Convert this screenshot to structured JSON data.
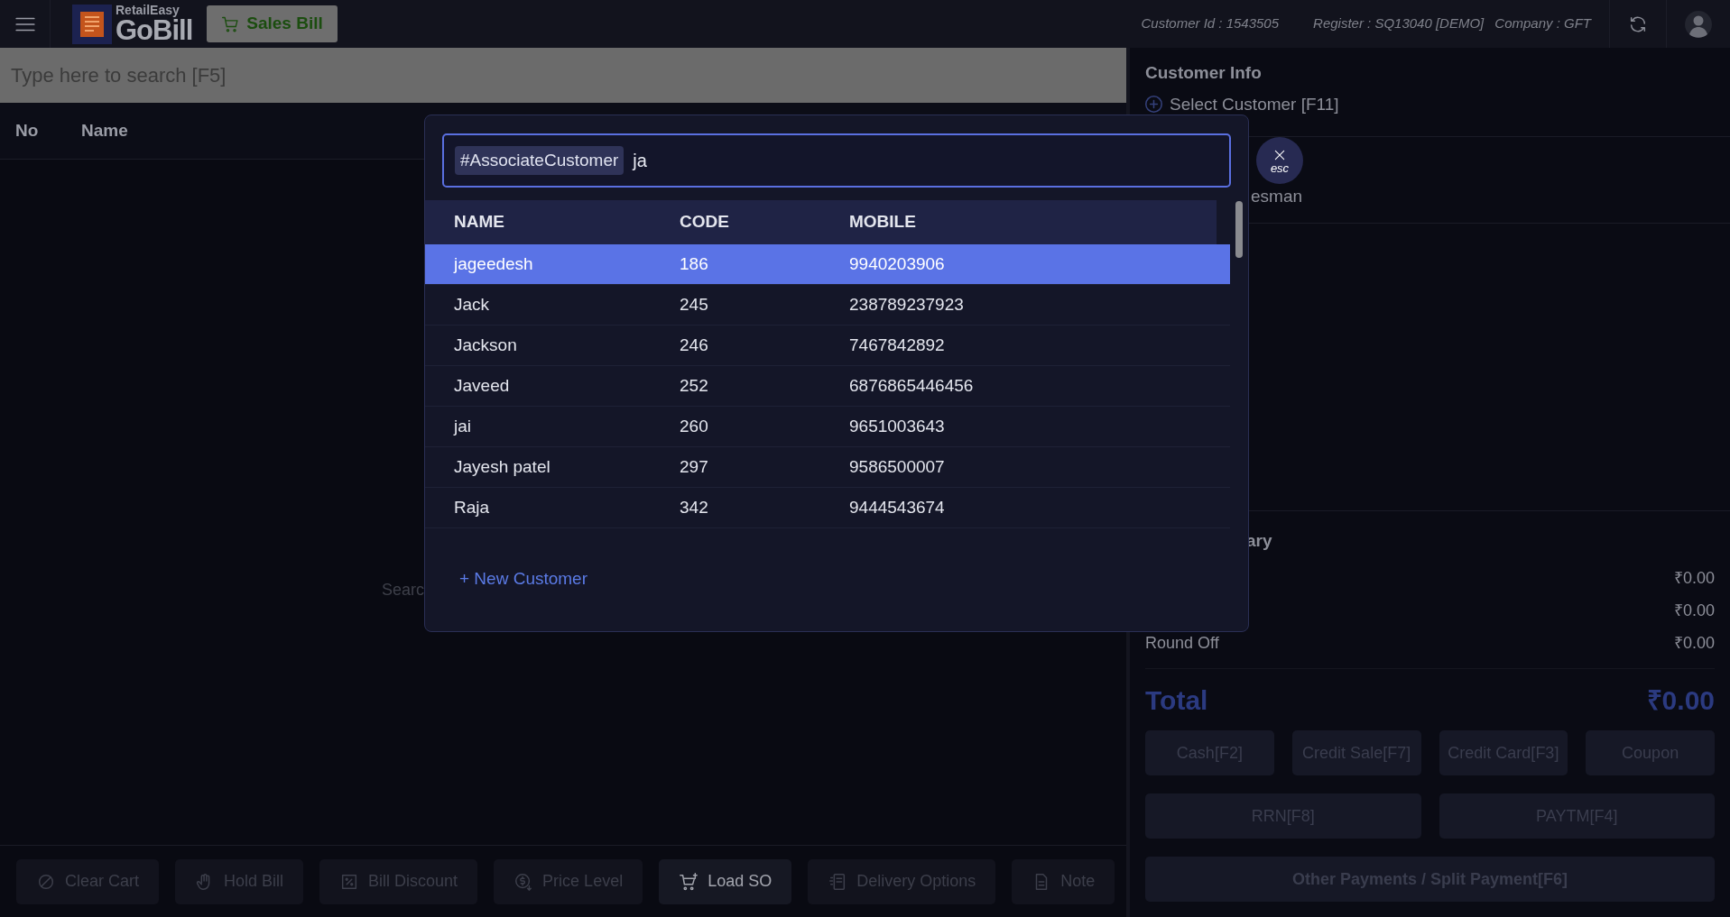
{
  "header": {
    "brand_small": "RetailEasy",
    "brand": "GoBill",
    "sales_button": "Sales Bill",
    "info": [
      "Customer Id : 1543505",
      "Register : SQ13040 [DEMO]",
      "Company : GFT"
    ]
  },
  "search": {
    "placeholder": "Type here to search [F5]"
  },
  "cart_table": {
    "columns": [
      "No",
      "Name"
    ],
    "empty_hint": "Searc"
  },
  "toolbar": [
    {
      "label": "Clear Cart",
      "disabled": true
    },
    {
      "label": "Hold Bill",
      "disabled": true
    },
    {
      "label": "Bill Discount",
      "disabled": true
    },
    {
      "label": "Price Level",
      "disabled": true
    },
    {
      "label": "Load SO",
      "disabled": false
    },
    {
      "label": "Delivery Options",
      "disabled": true
    },
    {
      "label": "Note",
      "disabled": true
    }
  ],
  "customer_panel": {
    "title": "Customer Info",
    "select_link": "Select Customer [F11]",
    "salesman_fragment": "esman"
  },
  "summary": {
    "title_fragment": "ary",
    "rows": [
      {
        "value": "₹0.00"
      },
      {
        "value": "₹0.00"
      },
      {
        "label": "Round Off",
        "value": "₹0.00"
      }
    ],
    "total_label": "Total",
    "total_value": "₹0.00"
  },
  "payments": [
    [
      {
        "label": "Cash[F2]",
        "disabled": true
      },
      {
        "label": "Credit Sale[F7]",
        "disabled": true
      },
      {
        "label": "Credit Card[F3]",
        "disabled": true
      },
      {
        "label": "Coupon",
        "disabled": true
      }
    ],
    [
      {
        "label": "RRN[F8]",
        "disabled": true
      },
      {
        "label": "PAYTM[F4]",
        "disabled": true
      }
    ],
    [
      {
        "label": "Other Payments / Split Payment[F6]",
        "disabled": true
      }
    ]
  ],
  "dialog": {
    "tag": "#AssociateCustomer",
    "query": "ja",
    "columns": [
      "NAME",
      "CODE",
      "MOBILE"
    ],
    "rows": [
      {
        "name": "jageedesh",
        "code": "186",
        "mobile": "9940203906",
        "selected": true
      },
      {
        "name": "Jack",
        "code": "245",
        "mobile": "238789237923",
        "selected": false
      },
      {
        "name": "Jackson",
        "code": "246",
        "mobile": "7467842892",
        "selected": false
      },
      {
        "name": "Javeed",
        "code": "252",
        "mobile": "6876865446456",
        "selected": false
      },
      {
        "name": "jai",
        "code": "260",
        "mobile": "9651003643",
        "selected": false
      },
      {
        "name": "Jayesh patel",
        "code": "297",
        "mobile": "9586500007",
        "selected": false
      },
      {
        "name": "Raja",
        "code": "342",
        "mobile": "9444543674",
        "selected": false
      }
    ],
    "new_link": "+ New Customer",
    "close_label": "esc"
  }
}
